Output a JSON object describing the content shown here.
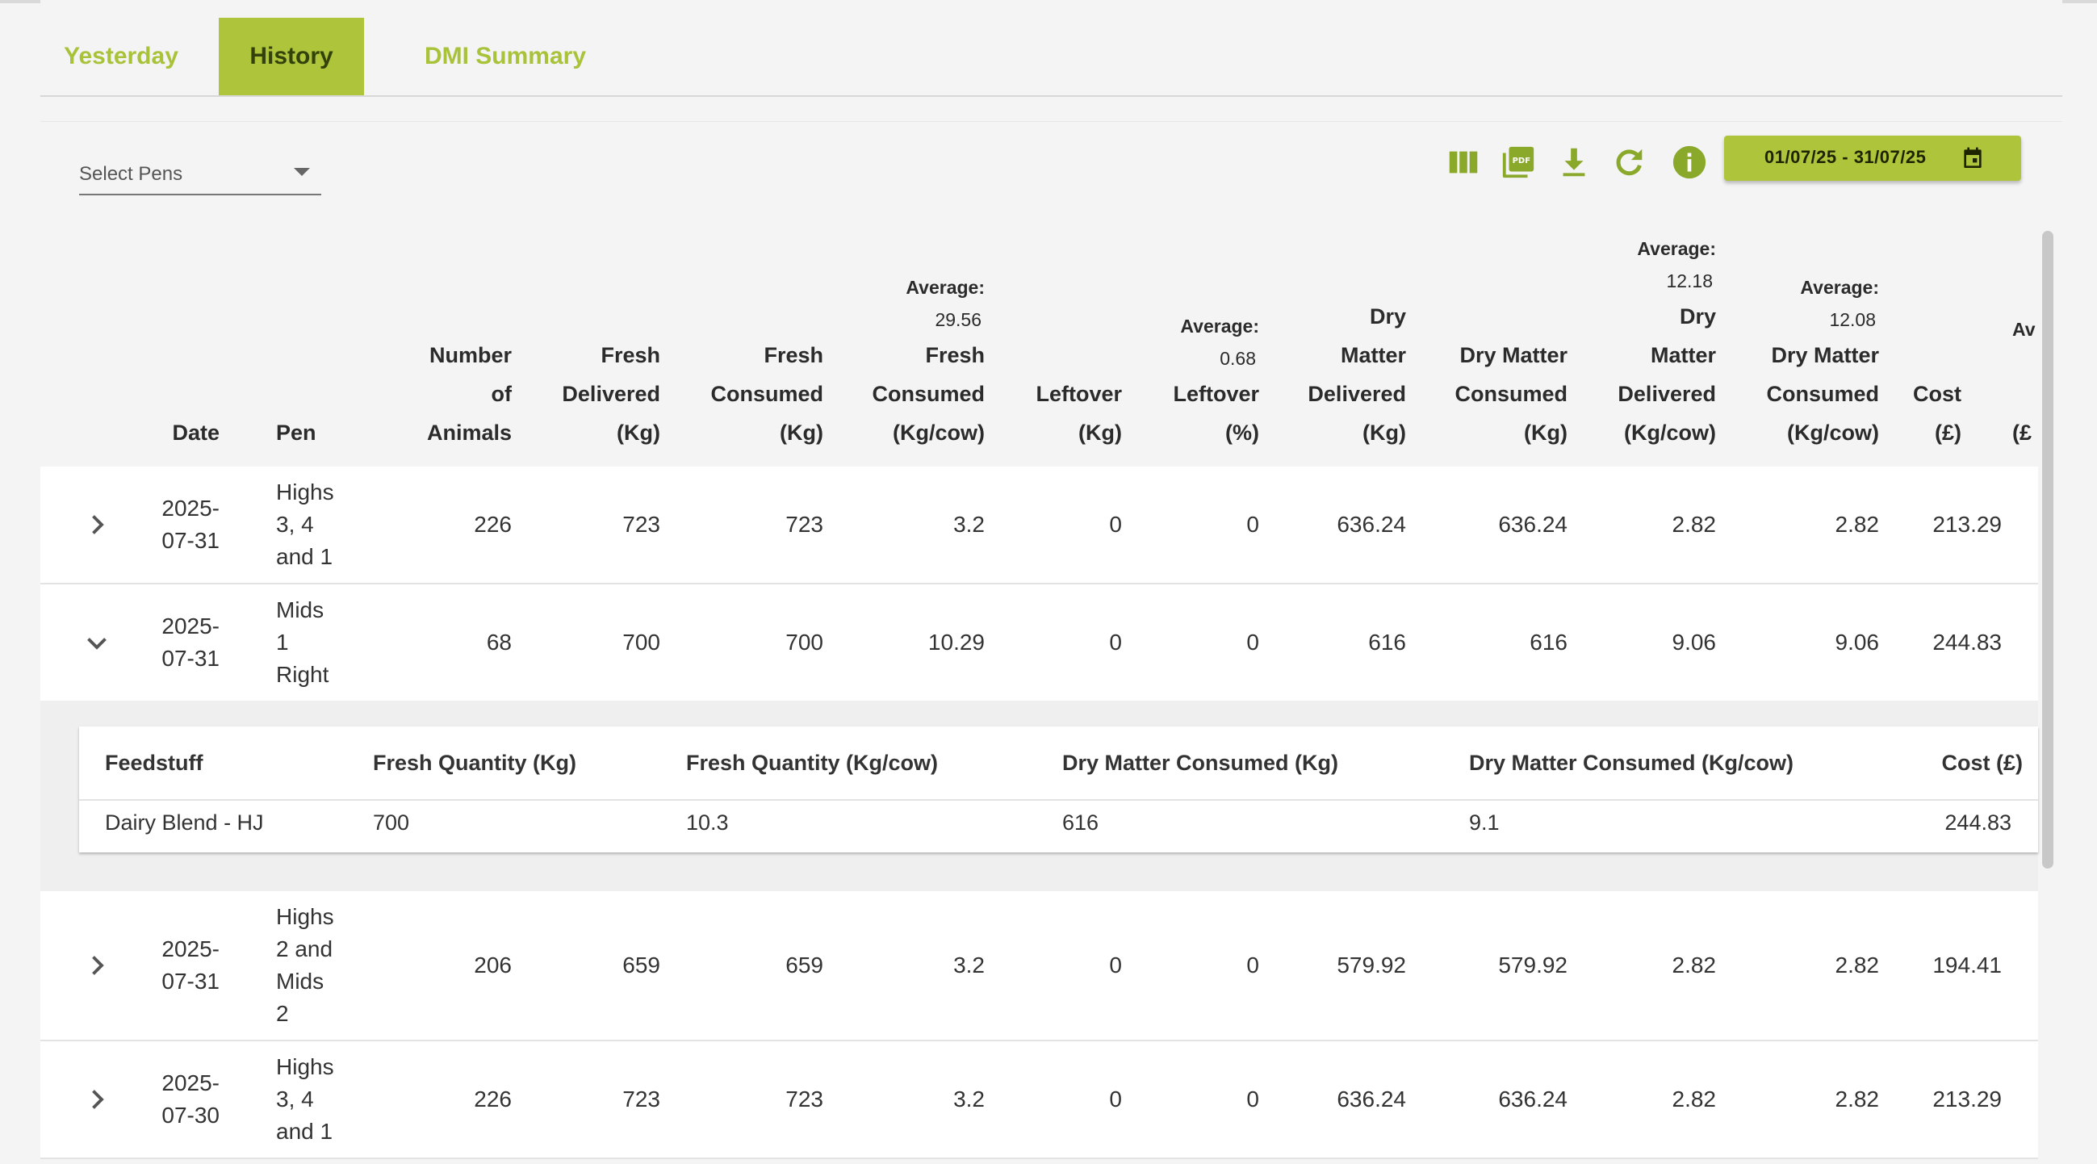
{
  "tabs": [
    "Yesterday",
    "History",
    "DMI Summary"
  ],
  "active_tab": "History",
  "pen_select": {
    "label": "Select Pens"
  },
  "toolbar": {
    "icons": [
      "columns-icon",
      "pdf-icon",
      "download-icon",
      "refresh-icon",
      "info-icon"
    ],
    "date_range": "01/07/25 - 31/07/25"
  },
  "colors": {
    "accent": "#adc43b",
    "accent_text": "#a8c23a"
  },
  "columns": {
    "date": [
      "Date"
    ],
    "pen": [
      "Pen"
    ],
    "animals": [
      "Number",
      "of",
      "Animals"
    ],
    "fresh_delivered": [
      "Fresh",
      "Delivered",
      "(Kg)"
    ],
    "fresh_consumed": [
      "Fresh",
      "Consumed",
      "(Kg)"
    ],
    "fresh_consumed_cow": {
      "avg_label": "Average:",
      "avg_value": "29.56",
      "lines": [
        "Fresh",
        "Consumed",
        "(Kg/cow)"
      ]
    },
    "leftover": [
      "Leftover",
      "(Kg)"
    ],
    "leftover_pct": {
      "avg_label": "Average:",
      "avg_value": "0.68",
      "lines": [
        "Leftover",
        "(%)"
      ]
    },
    "dm_delivered": [
      "Dry",
      "Matter",
      "Delivered",
      "(Kg)"
    ],
    "dm_consumed": [
      "Dry Matter",
      "Consumed",
      "(Kg)"
    ],
    "dm_delivered_cow": {
      "avg_label": "Average:",
      "avg_value": "12.18",
      "lines": [
        "Dry",
        "Matter",
        "Delivered",
        "(Kg/cow)"
      ]
    },
    "dm_consumed_cow": {
      "avg_label": "Average:",
      "avg_value": "12.08",
      "lines": [
        "Dry Matter",
        "Consumed",
        "(Kg/cow)"
      ]
    },
    "cost": [
      "Cost",
      "(£)"
    ],
    "cut_avg": "Av",
    "cut_unit": "(£"
  },
  "rows": [
    {
      "date": [
        "2025-",
        "07-31"
      ],
      "pen": [
        "Highs",
        "3, 4",
        "and 1"
      ],
      "animals": "226",
      "fresh_delivered": "723",
      "fresh_consumed": "723",
      "fresh_consumed_cow": "3.2",
      "leftover": "0",
      "leftover_pct": "0",
      "dm_delivered": "636.24",
      "dm_consumed": "636.24",
      "dm_delivered_cow": "2.82",
      "dm_consumed_cow": "2.82",
      "cost": "213.29",
      "expanded": false
    },
    {
      "date": [
        "2025-",
        "07-31"
      ],
      "pen": [
        "Mids",
        "1",
        "Right"
      ],
      "animals": "68",
      "fresh_delivered": "700",
      "fresh_consumed": "700",
      "fresh_consumed_cow": "10.29",
      "leftover": "0",
      "leftover_pct": "0",
      "dm_delivered": "616",
      "dm_consumed": "616",
      "dm_delivered_cow": "9.06",
      "dm_consumed_cow": "9.06",
      "cost": "244.83",
      "expanded": true
    },
    {
      "date": [
        "2025-",
        "07-31"
      ],
      "pen": [
        "Highs",
        "2 and",
        "Mids",
        "2"
      ],
      "animals": "206",
      "fresh_delivered": "659",
      "fresh_consumed": "659",
      "fresh_consumed_cow": "3.2",
      "leftover": "0",
      "leftover_pct": "0",
      "dm_delivered": "579.92",
      "dm_consumed": "579.92",
      "dm_delivered_cow": "2.82",
      "dm_consumed_cow": "2.82",
      "cost": "194.41",
      "expanded": false
    },
    {
      "date": [
        "2025-",
        "07-30"
      ],
      "pen": [
        "Highs",
        "3, 4",
        "and 1"
      ],
      "animals": "226",
      "fresh_delivered": "723",
      "fresh_consumed": "723",
      "fresh_consumed_cow": "3.2",
      "leftover": "0",
      "leftover_pct": "0",
      "dm_delivered": "636.24",
      "dm_consumed": "636.24",
      "dm_delivered_cow": "2.82",
      "dm_consumed_cow": "2.82",
      "cost": "213.29",
      "expanded": false
    }
  ],
  "detail": {
    "headers": [
      "Feedstuff",
      "Fresh Quantity (Kg)",
      "Fresh Quantity (Kg/cow)",
      "Dry Matter Consumed (Kg)",
      "Dry Matter Consumed (Kg/cow)",
      "Cost (£)"
    ],
    "rows": [
      [
        "Dairy Blend - HJ",
        "700",
        "10.3",
        "616",
        "9.1",
        "244.83"
      ]
    ]
  }
}
